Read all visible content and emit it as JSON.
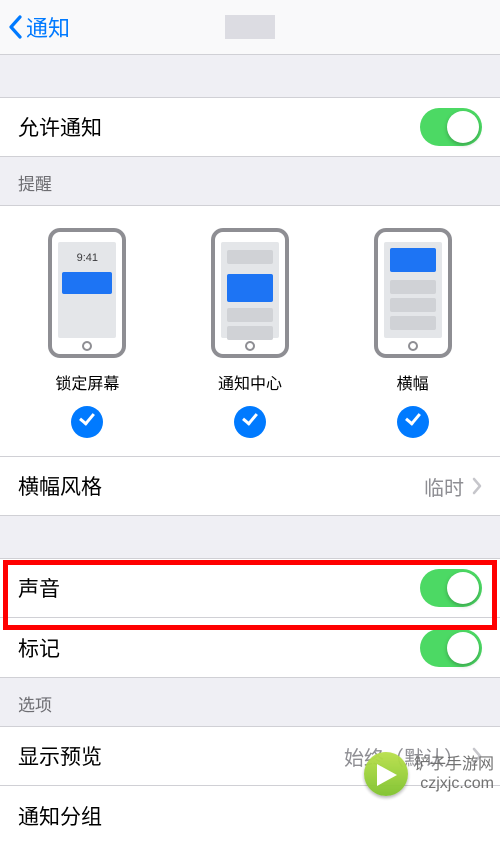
{
  "header": {
    "back_label": "通知"
  },
  "allow": {
    "label": "允许通知",
    "on": true
  },
  "alerts": {
    "section": "提醒",
    "lock": {
      "caption": "锁定屏幕",
      "time": "9:41",
      "checked": true
    },
    "center": {
      "caption": "通知中心",
      "checked": true
    },
    "banner": {
      "caption": "横幅",
      "checked": true
    }
  },
  "banner_style": {
    "label": "横幅风格",
    "value": "临时"
  },
  "sound": {
    "label": "声音",
    "on": true
  },
  "badge": {
    "label": "标记",
    "on": true
  },
  "options_header": "选项",
  "preview": {
    "label": "显示预览",
    "value": "始终（默认）"
  },
  "grouping": {
    "label": "通知分组"
  },
  "watermark": {
    "line1": "铲子手游网",
    "line2": "czjxjc.com"
  }
}
